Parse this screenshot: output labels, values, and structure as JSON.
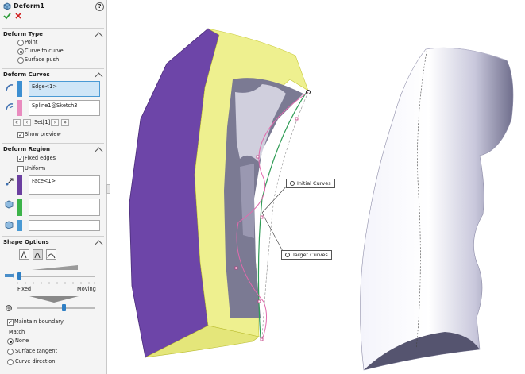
{
  "header": {
    "title": "Deform1"
  },
  "deform_type": {
    "title": "Deform Type",
    "options": [
      "Point",
      "Curve to curve",
      "Surface push"
    ],
    "selected": "Curve to curve"
  },
  "deform_curves": {
    "title": "Deform Curves",
    "initial_field": "Edge<1>",
    "target_field": "Spline1@Sketch3",
    "set_label": "Set[1]",
    "show_preview": "Show preview"
  },
  "deform_region": {
    "title": "Deform Region",
    "fixed_edges": "Fixed edges",
    "uniform": "Uniform",
    "face_field": "Face<1>"
  },
  "shape_options": {
    "title": "Shape Options",
    "fixed_label": "Fixed",
    "moving_label": "Moving",
    "maintain_boundary": "Maintain boundary",
    "match_label": "Match",
    "match_options": [
      "None",
      "Surface tangent",
      "Curve direction"
    ],
    "match_selected": "None",
    "stiffness_level": 0.0,
    "shape_accuracy_level": 0.6
  },
  "callouts": {
    "initial": "Initial Curves",
    "target": "Target Curves"
  },
  "colors": {
    "accent_blue": "#4a9ad4",
    "swatch_initial": "#3d8fd1",
    "swatch_target": "#e98bbf",
    "swatch_face": "#6b3fa0",
    "swatch_green": "#3cb34a",
    "swatch_blue": "#4a9ad4",
    "purple_face": "#6d45a8",
    "yellow_face": "#eef08f"
  }
}
